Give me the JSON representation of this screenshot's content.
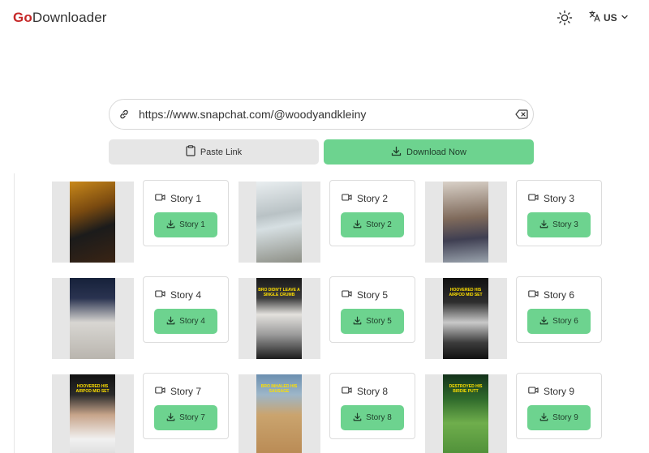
{
  "header": {
    "logo_prefix": "Go",
    "logo_suffix": "Downloader",
    "theme_icon": "sun-icon",
    "language_code": "US",
    "language_icon": "translate-icon"
  },
  "search": {
    "value": "https://www.snapchat.com/@woodyandkleiny",
    "link_icon": "link-icon",
    "clear_icon": "backspace-icon"
  },
  "actions": {
    "paste_label": "Paste Link",
    "download_label": "Download Now"
  },
  "colors": {
    "accent": "#6dd38f",
    "brand": "#c62828",
    "neutral_button": "#e6e6e6"
  },
  "stories": [
    {
      "title": "Story 1",
      "button": "Story 1",
      "caption": ""
    },
    {
      "title": "Story 2",
      "button": "Story 2",
      "caption": ""
    },
    {
      "title": "Story 3",
      "button": "Story 3",
      "caption": ""
    },
    {
      "title": "Story 4",
      "button": "Story 4",
      "caption": ""
    },
    {
      "title": "Story 5",
      "button": "Story 5",
      "caption": "BRO DIDN'T LEAVE A SINGLE CRUMB"
    },
    {
      "title": "Story 6",
      "button": "Story 6",
      "caption": "HOOVERED HIS AIRPOD MID SET"
    },
    {
      "title": "Story 7",
      "button": "Story 7",
      "caption": "HOOVERED HIS AIRPOD MID SET"
    },
    {
      "title": "Story 8",
      "button": "Story 8",
      "caption": "BRO INHALED HIS SAUSAGE"
    },
    {
      "title": "Story 9",
      "button": "Story 9",
      "caption": "DESTROYED HIS BIRDIE PUTT"
    }
  ]
}
